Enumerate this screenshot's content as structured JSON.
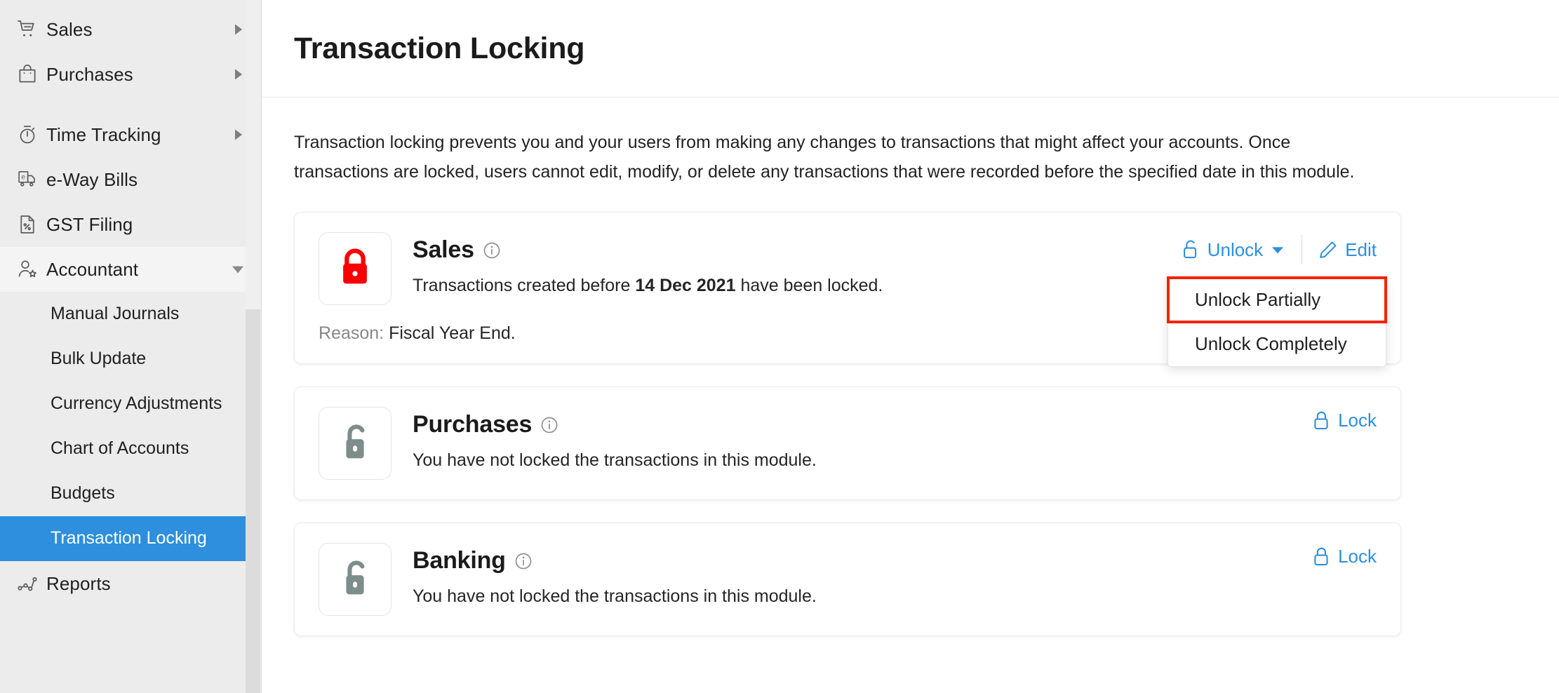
{
  "sidebar": {
    "items": [
      {
        "label": "Sales",
        "icon": "cart-icon",
        "caret": "right",
        "type": "parent"
      },
      {
        "label": "Purchases",
        "icon": "bag-icon",
        "caret": "right",
        "type": "parent"
      },
      {
        "label": "Time Tracking",
        "icon": "timer-icon",
        "caret": "right",
        "type": "parent"
      },
      {
        "label": "e-Way Bills",
        "icon": "truck-icon",
        "caret": "none",
        "type": "parent"
      },
      {
        "label": "GST Filing",
        "icon": "document-percent-icon",
        "caret": "none",
        "type": "parent"
      },
      {
        "label": "Accountant",
        "icon": "accountant-icon",
        "caret": "down",
        "type": "parent",
        "expanded": true
      }
    ],
    "sub_items": [
      {
        "label": "Manual Journals",
        "active": false
      },
      {
        "label": "Bulk Update",
        "active": false
      },
      {
        "label": "Currency Adjustments",
        "active": false
      },
      {
        "label": "Chart of Accounts",
        "active": false
      },
      {
        "label": "Budgets",
        "active": false
      },
      {
        "label": "Transaction Locking",
        "active": true
      }
    ],
    "footer_items": [
      {
        "label": "Reports",
        "icon": "analytics-icon",
        "caret": "none"
      }
    ],
    "active_color": "#2d8fdd"
  },
  "header": {
    "title": "Transaction Locking"
  },
  "main": {
    "intro": "Transaction locking prevents you and your users from making any changes to transactions that might affect your accounts. Once transactions are locked, users cannot edit, modify, or delete any transactions that were recorded before the specified date in this module.",
    "cards": [
      {
        "title": "Sales",
        "state": "locked",
        "lock_icon": "lock-closed-icon",
        "lock_color": "#fa0000",
        "desc_prefix": "Transactions created before ",
        "desc_date": "14 Dec 2021",
        "desc_suffix": " have been locked.",
        "reason_label": "Reason: ",
        "reason_value": "Fiscal Year End.",
        "actions": {
          "unlock_label": "Unlock",
          "unlock_icon": "lock-open-icon",
          "edit_label": "Edit",
          "edit_icon": "pencil-icon"
        },
        "dropdown": {
          "open": true,
          "items": [
            {
              "label": "Unlock Partially",
              "highlighted": true
            },
            {
              "label": "Unlock Completely",
              "highlighted": false
            }
          ],
          "highlight_color": "#f52300"
        }
      },
      {
        "title": "Purchases",
        "state": "unlocked",
        "lock_icon": "lock-open-icon",
        "lock_color": "#7c8d8c",
        "desc_full": "You have not locked the transactions in this module.",
        "actions": {
          "lock_label": "Lock",
          "lock_icon": "lock-closed-outline-icon"
        }
      },
      {
        "title": "Banking",
        "state": "unlocked",
        "lock_icon": "lock-open-icon",
        "lock_color": "#7c8d8c",
        "desc_full": "You have not locked the transactions in this module.",
        "actions": {
          "lock_label": "Lock",
          "lock_icon": "lock-closed-outline-icon"
        }
      }
    ]
  }
}
